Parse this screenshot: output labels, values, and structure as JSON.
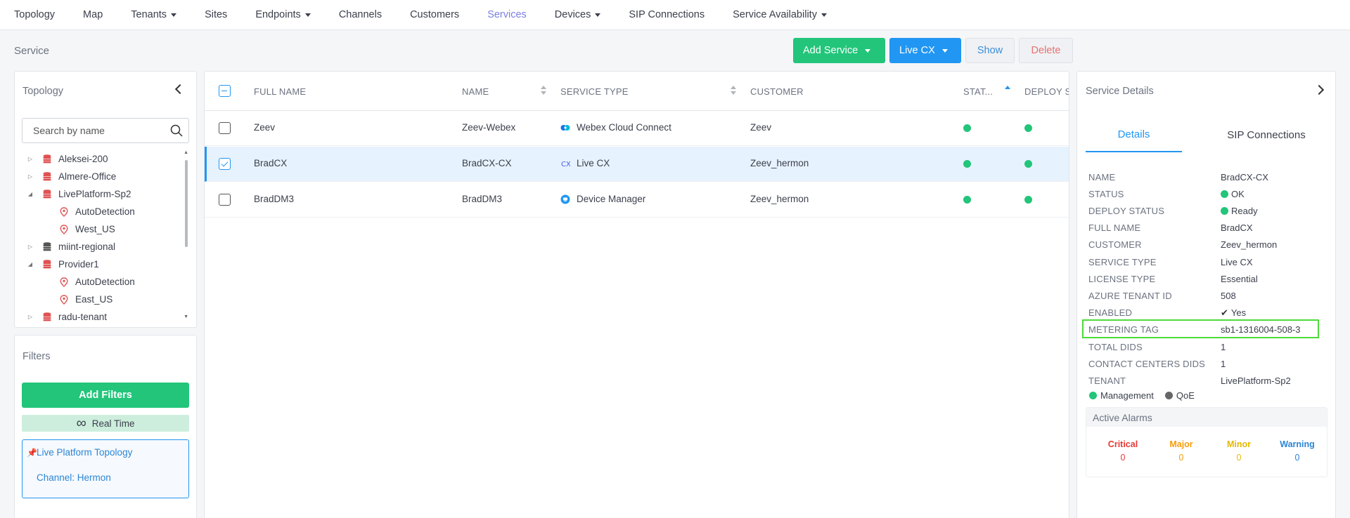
{
  "nav": {
    "items": [
      {
        "label": "Topology",
        "dropdown": false,
        "active": false
      },
      {
        "label": "Map",
        "dropdown": false,
        "active": false
      },
      {
        "label": "Tenants",
        "dropdown": true,
        "active": false
      },
      {
        "label": "Sites",
        "dropdown": false,
        "active": false
      },
      {
        "label": "Endpoints",
        "dropdown": true,
        "active": false
      },
      {
        "label": "Channels",
        "dropdown": false,
        "active": false
      },
      {
        "label": "Customers",
        "dropdown": false,
        "active": false
      },
      {
        "label": "Services",
        "dropdown": false,
        "active": true
      },
      {
        "label": "Devices",
        "dropdown": true,
        "active": false
      },
      {
        "label": "SIP Connections",
        "dropdown": false,
        "active": false
      },
      {
        "label": "Service Availability",
        "dropdown": true,
        "active": false
      }
    ]
  },
  "page": {
    "title": "Service"
  },
  "toolbar": {
    "add_service": "Add Service",
    "live_cx": "Live CX",
    "show": "Show",
    "delete": "Delete"
  },
  "topology": {
    "title": "Topology",
    "search_placeholder": "Search by name",
    "tree": [
      {
        "label": "Aleksei-200",
        "type": "tenant",
        "expand": "collapsed",
        "color": "#e05252"
      },
      {
        "label": "Almere-Office",
        "type": "tenant",
        "expand": "collapsed",
        "color": "#e05252"
      },
      {
        "label": "LivePlatform-Sp2",
        "type": "tenant",
        "expand": "expanded",
        "color": "#e05252"
      },
      {
        "label": "AutoDetection",
        "type": "region",
        "color": "#e05252"
      },
      {
        "label": "West_US",
        "type": "region",
        "color": "#e05252"
      },
      {
        "label": "miint-regional",
        "type": "tenant",
        "expand": "collapsed",
        "color": "#555555"
      },
      {
        "label": "Provider1",
        "type": "tenant",
        "expand": "expanded",
        "color": "#e05252"
      },
      {
        "label": "AutoDetection",
        "type": "region",
        "color": "#e05252"
      },
      {
        "label": "East_US",
        "type": "region",
        "color": "#e05252"
      },
      {
        "label": "radu-tenant",
        "type": "tenant",
        "expand": "collapsed",
        "color": "#e05252"
      }
    ]
  },
  "filters": {
    "title": "Filters",
    "add_label": "Add Filters",
    "realtime_label": "Real Time",
    "active": [
      "Live Platform Topology",
      "Channel: Hermon"
    ]
  },
  "table": {
    "headers": {
      "full_name": "FULL NAME",
      "name": "NAME",
      "service_type": "SERVICE TYPE",
      "customer": "CUSTOMER",
      "status": "STAT...",
      "deploy": "DEPLOY S"
    },
    "rows": [
      {
        "full_name": "Zeev",
        "name": "Zeev-Webex",
        "service_type": "Webex Cloud Connect",
        "icon": "webex-icon",
        "customer": "Zeev",
        "selected": false
      },
      {
        "full_name": "BradCX",
        "name": "BradCX-CX",
        "service_type": "Live CX",
        "icon": "cx-icon",
        "customer": "Zeev_hermon",
        "selected": true
      },
      {
        "full_name": "BradDM3",
        "name": "BradDM3",
        "service_type": "Device Manager",
        "icon": "device-manager-icon",
        "customer": "Zeev_hermon",
        "selected": false
      }
    ]
  },
  "details": {
    "title": "Service Details",
    "tabs": [
      "Details",
      "SIP Connections"
    ],
    "fields": [
      {
        "key": "NAME",
        "value": "BradCX-CX"
      },
      {
        "key": "STATUS",
        "value": "OK",
        "dot": "#22c57a"
      },
      {
        "key": "DEPLOY STATUS",
        "value": "Ready",
        "dot": "#22c57a"
      },
      {
        "key": "FULL NAME",
        "value": "BradCX"
      },
      {
        "key": "CUSTOMER",
        "value": "Zeev_hermon"
      },
      {
        "key": "SERVICE TYPE",
        "value": "Live CX"
      },
      {
        "key": "LICENSE TYPE",
        "value": "Essential"
      },
      {
        "key": "AZURE TENANT ID",
        "value": "508"
      },
      {
        "key": "ENABLED",
        "value": "Yes",
        "check": true
      },
      {
        "key": "METERING TAG",
        "value": "sb1-1316004-508-3"
      },
      {
        "key": "TOTAL DIDS",
        "value": "1"
      },
      {
        "key": "CONTACT CENTERS DIDS",
        "value": "1"
      },
      {
        "key": "TENANT",
        "value": "LivePlatform-Sp2"
      }
    ],
    "legend": [
      {
        "label": "Management",
        "color": "#22c57a"
      },
      {
        "label": "QoE",
        "color": "#666666"
      }
    ],
    "alarms": {
      "title": "Active Alarms",
      "items": [
        {
          "label": "Critical",
          "count": "0",
          "color": "#e53935"
        },
        {
          "label": "Major",
          "count": "0",
          "color": "#f59e0b"
        },
        {
          "label": "Minor",
          "count": "0",
          "color": "#e5b800"
        },
        {
          "label": "Warning",
          "count": "0",
          "color": "#2b86d6"
        }
      ]
    }
  }
}
